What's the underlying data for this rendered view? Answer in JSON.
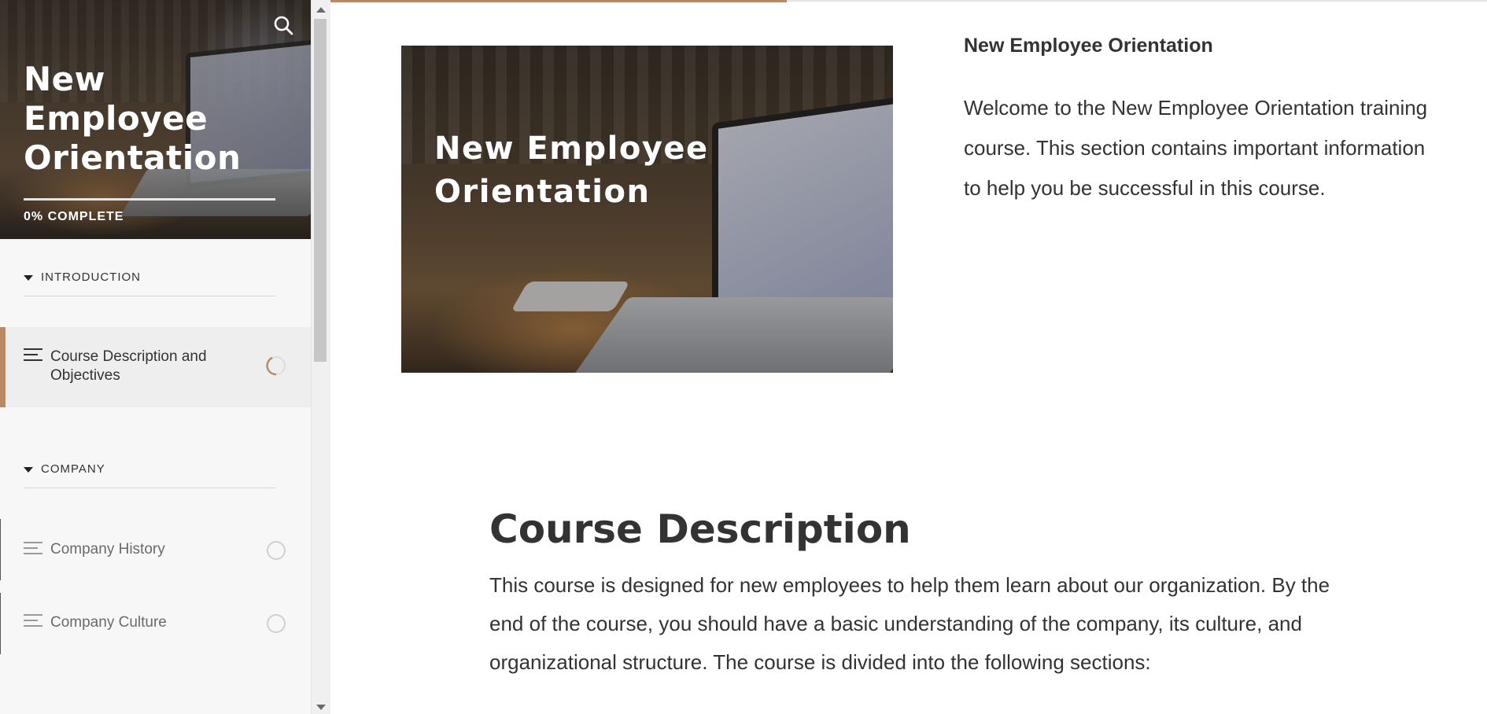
{
  "sidebar": {
    "course_title": "New Employee Orientation",
    "progress_percent": 0,
    "progress_text": "0% COMPLETE",
    "search_icon": "search-icon",
    "sections": [
      {
        "label": "INTRODUCTION",
        "lessons": [
          {
            "title": "Course Description and Objectives",
            "status": "in-progress",
            "active": true
          }
        ]
      },
      {
        "label": "COMPANY",
        "lessons": [
          {
            "title": "Company History",
            "status": "not-started",
            "active": false
          },
          {
            "title": "Company Culture",
            "status": "not-started",
            "active": false
          }
        ]
      }
    ]
  },
  "main": {
    "media_title": "New Employee Orientation",
    "intro_title": "New Employee Orientation",
    "intro_text": "Welcome to the New Employee Orientation training course. This section contains important information to help you be successful in this course.",
    "course_description_heading": "Course Description",
    "course_description_text": "This course is designed for new employees to help them learn about our organization. By the end of the course, you should have a basic understanding of the company, its culture, and organizational structure. The course is divided into the following sections:"
  },
  "colors": {
    "accent": "#b88966",
    "text": "#333333",
    "sidebar_bg": "#f7f7f7"
  }
}
